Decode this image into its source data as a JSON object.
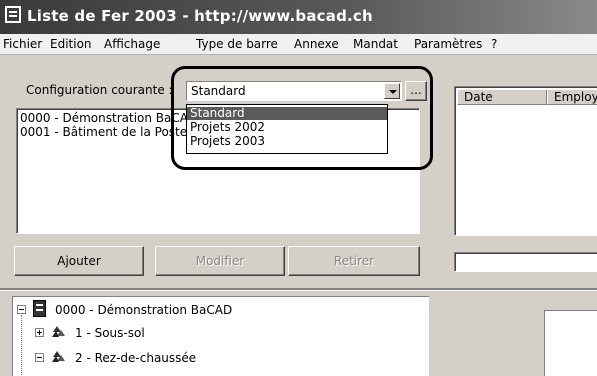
{
  "window": {
    "title": "Liste de Fer 2003 - http://www.bacad.ch"
  },
  "menu": [
    "Fichier",
    "Edition",
    "Affichage",
    "Type de barre",
    "Annexe",
    "Mandat",
    "Paramètres",
    "?"
  ],
  "config": {
    "label": "Configuration courante :",
    "selected": "Standard",
    "browse_label": "...",
    "options": [
      "Standard",
      "Projets 2002",
      "Projets 2003"
    ]
  },
  "projects": [
    "0000 - Démonstration BaCAD",
    "0001 - Bâtiment de la Poste"
  ],
  "buttons": {
    "add": "Ajouter",
    "modify": "Modifier",
    "remove": "Retirer"
  },
  "table": {
    "columns": [
      "Date",
      "Employé"
    ]
  },
  "tree": {
    "root": "0000 - Démonstration BaCAD",
    "children": [
      "1 - Sous-sol",
      "2 - Rez-de-chaussée"
    ]
  }
}
